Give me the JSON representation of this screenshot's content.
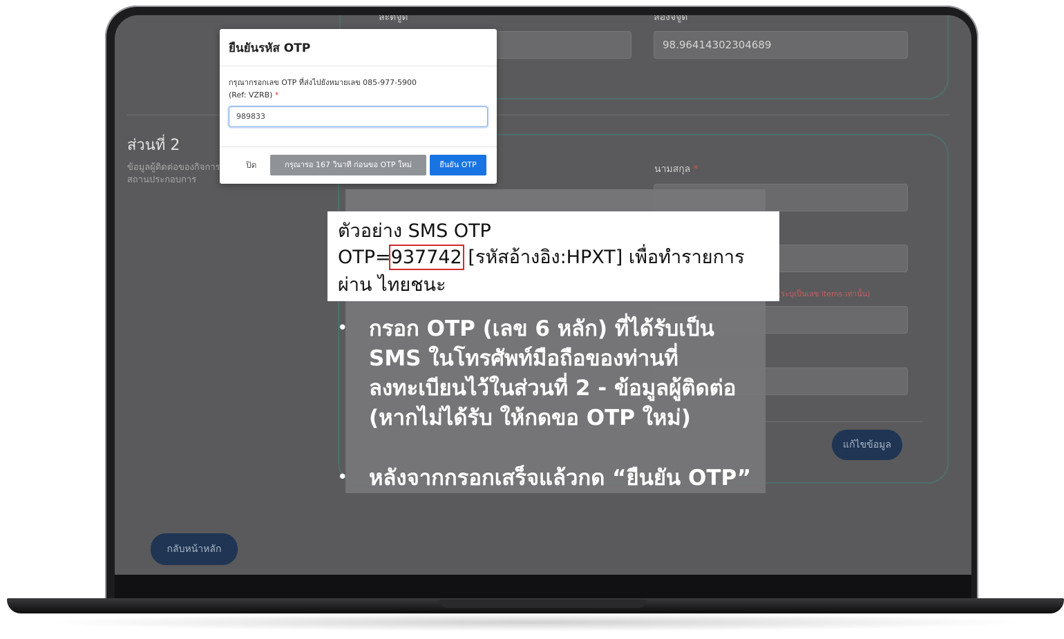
{
  "background_form": {
    "top_left_label": "ละติจูด",
    "top_right_label": "ลองจิจูด",
    "longitude_value": "98.96414302304689",
    "section_title": "ส่วนที่ 2",
    "section_desc": "ข้อมูลผู้ติดต่อของกิจการ สถานประกอบการ",
    "lastname_label": "นามสกุล",
    "lastname_required": "*",
    "right_note": "(ระบุเป็นเลข items เท่านั้น)",
    "edit_button": "แก้ไขข้อมูล",
    "home_button": "กลับหน้าหลัก"
  },
  "otp_modal": {
    "title": "ยืนยันรหัส OTP",
    "message": "กรุณากรอกเลข OTP ที่ส่งไปยังหมายเลข 085-977-5900",
    "ref": "(Ref: VZRB)",
    "required_mark": "*",
    "input_value": "989833",
    "close_label": "ปิด",
    "wait_label": "กรุณารอ 167 วินาที ก่อนขอ OTP ใหม่",
    "confirm_label": "ยืนยัน OTP"
  },
  "sms_example": {
    "title": "ตัวอย่าง SMS OTP",
    "otp_prefix": "OTP=",
    "otp_code": "937742",
    "otp_suffix": " [รหัสอ้างอิง:HPXT] เพื่อทำรายการ",
    "line3": "ผ่าน ไทยชนะ"
  },
  "instructions": {
    "bullet1": [
      "กรอก OTP (เลข 6 หลัก) ที่ได้รับเป็น",
      "SMS ในโทรศัพท์มือถือของท่านที่",
      "ลงทะเบียนไว้ในส่วนที่ 2 - ข้อมูลผู้ติดต่อ",
      "(หากไม่ได้รับ ให้กดขอ OTP ใหม่)"
    ],
    "bullet2": "หลังจากกรอกเสร็จแล้วกด “ยืนยัน OTP”",
    "bullet_symbol": "•"
  }
}
